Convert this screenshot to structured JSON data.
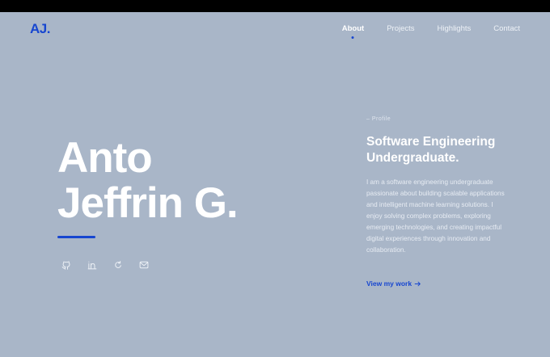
{
  "header": {
    "logo": "AJ.",
    "nav": [
      {
        "label": "About",
        "active": true
      },
      {
        "label": "Projects",
        "active": false
      },
      {
        "label": "Highlights",
        "active": false
      },
      {
        "label": "Contact",
        "active": false
      }
    ]
  },
  "hero": {
    "name_line1": "Anto",
    "name_line2": "Jeffrin G.",
    "socials": [
      {
        "icon": "github-icon"
      },
      {
        "icon": "linkedin-icon"
      },
      {
        "icon": "refresh-icon"
      },
      {
        "icon": "mail-icon"
      }
    ]
  },
  "profile": {
    "kicker": "– Profile",
    "headline_line1": "Software Engineering",
    "headline_line2": "Undergraduate.",
    "bio": "I am a software engineering undergraduate passionate about building scalable applications and intelligent machine learning solutions. I enjoy solving complex problems, exploring emerging technologies, and creating impactful digital experiences through innovation and collaboration.",
    "cta": "View my work"
  },
  "colors": {
    "background": "#a9b6c8",
    "accent": "#1746d0",
    "text": "#ffffff"
  }
}
